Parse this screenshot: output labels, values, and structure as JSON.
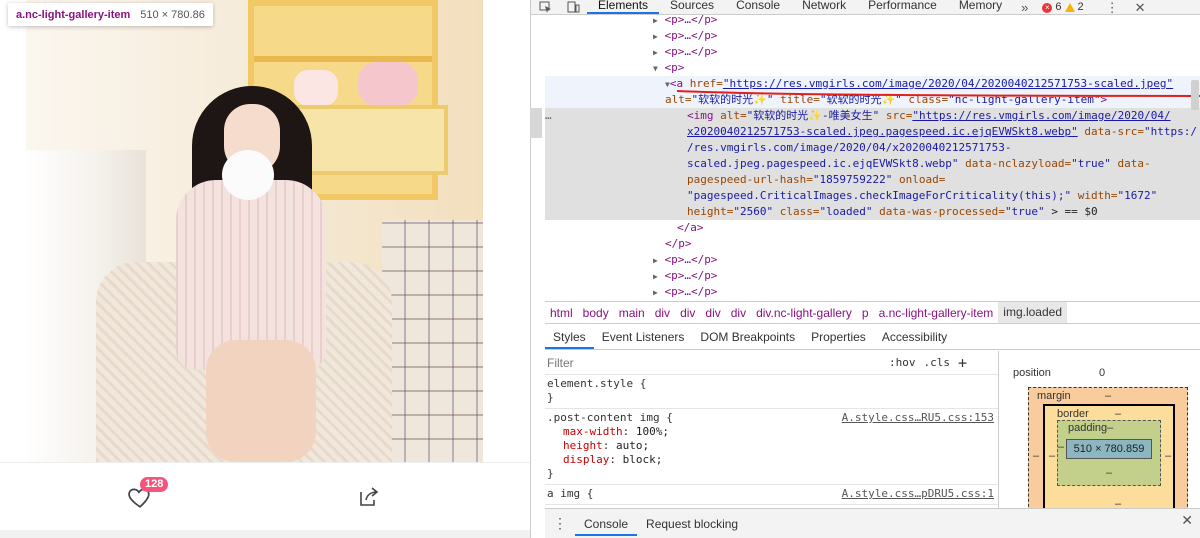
{
  "inspect_tooltip": {
    "selector": "a.nc-light-gallery-item",
    "size": "510 × 780.86"
  },
  "page": {
    "like_count": "128"
  },
  "devtools": {
    "tabs": [
      "Elements",
      "Sources",
      "Console",
      "Network",
      "Performance",
      "Memory"
    ],
    "more_tabs": "»",
    "errors": "6",
    "warnings": "2",
    "kebab": "⋮",
    "close": "✕",
    "elements_lines": {
      "p1": "<p>…</p>",
      "p2": "<p>…</p>",
      "p3": "<p>…</p>",
      "p_open": "<p>",
      "a_tag": "<a",
      "a_href_attr": "href=",
      "a_href_val": "\"https://res.vmgirls.com/image/2020/04/2020040212571753-scaled.jpeg\"",
      "a_alt_attr": "alt=",
      "a_alt_val": "\"软软的时光✨\"",
      "a_title_attr": "title=",
      "a_title_val": "\"软软的时光✨\"",
      "a_class_attr": "class=",
      "a_class_val": "\"nc-light-gallery-item\"",
      "a_end": ">",
      "img_tag": "<img",
      "img_alt_attr": "alt=",
      "img_alt_val": "\"软软的时光✨-唯美女生\"",
      "img_src_attr": "src=",
      "img_src_val_1": "\"https://res.vmgirls.com/image/2020/04/",
      "img_src_val_2": "x2020040212571753-scaled.jpeg.pagespeed.ic.ejqEVWSkt8.webp\"",
      "img_datasrc_attr": "data-src=",
      "img_datasrc_val_1": "\"https:/",
      "img_datasrc_val_2": "/res.vmgirls.com/image/2020/04/x2020040212571753-",
      "img_datasrc_val_3": "scaled.jpeg.pagespeed.ic.ejqEVWSkt8.webp\"",
      "img_nclazy_attr": "data-nclazyload=",
      "img_nclazy_val": "\"true\"",
      "img_pagespeed_attr_1": "data-",
      "img_pagespeed_attr_2": "pagespeed-url-hash=",
      "img_pagespeed_val": "\"1859759222\"",
      "img_onload_attr": "onload=",
      "img_onload_val": "\"pagespeed.CriticalImages.checkImageForCriticality(this);\"",
      "img_width_attr": "width=",
      "img_width_val": "\"1672\"",
      "img_height_attr": "height=",
      "img_height_val": "\"2560\"",
      "img_class_attr": "class=",
      "img_class_val": "\"loaded\"",
      "img_processed_attr": "data-was-processed=",
      "img_processed_val": "\"true\"",
      "img_end": "> == $0",
      "a_close": "</a>",
      "p_close": "</p>",
      "p4": "<p>…</p>",
      "p5": "<p>…</p>",
      "p6": "<p>…</p>",
      "dots": "…"
    },
    "breadcrumb": [
      "html",
      "body",
      "main",
      "div",
      "div",
      "div",
      "div",
      "div.nc-light-gallery",
      "p",
      "a.nc-light-gallery-item",
      "img.loaded"
    ],
    "subtabs": [
      "Styles",
      "Event Listeners",
      "DOM Breakpoints",
      "Properties",
      "Accessibility"
    ],
    "styles": {
      "filter_placeholder": "Filter",
      "hov": ":hov",
      "cls": ".cls",
      "plus": "+",
      "rule1_selector": "element.style {",
      "rule1_close": "}",
      "rule2_selector": ".post-content img {",
      "rule2_source": "A.style.css…RU5.css:153",
      "rule2_props": [
        {
          "name": "max-width",
          "value": "100%;"
        },
        {
          "name": "height",
          "value": "auto;"
        },
        {
          "name": "display",
          "value": "block;"
        }
      ],
      "rule2_close": "}",
      "rule3_selector": "a img {",
      "rule3_source": "A.style.css…pDRU5.css:1"
    },
    "box_model": {
      "position_label": "position",
      "position_value": "0",
      "margin_label": "margin",
      "margin_value": "–",
      "border_label": "border",
      "border_value": "–",
      "padding_label": "padding–",
      "content": "510 × 780.859",
      "dash": "–"
    },
    "drawer": {
      "tabs": [
        "Console",
        "Request blocking"
      ]
    }
  },
  "colors": {
    "accent": "#1a73e8",
    "badge": "#f5557a",
    "tag": "#881280",
    "attr": "#994500",
    "value": "#1a1aa6"
  }
}
